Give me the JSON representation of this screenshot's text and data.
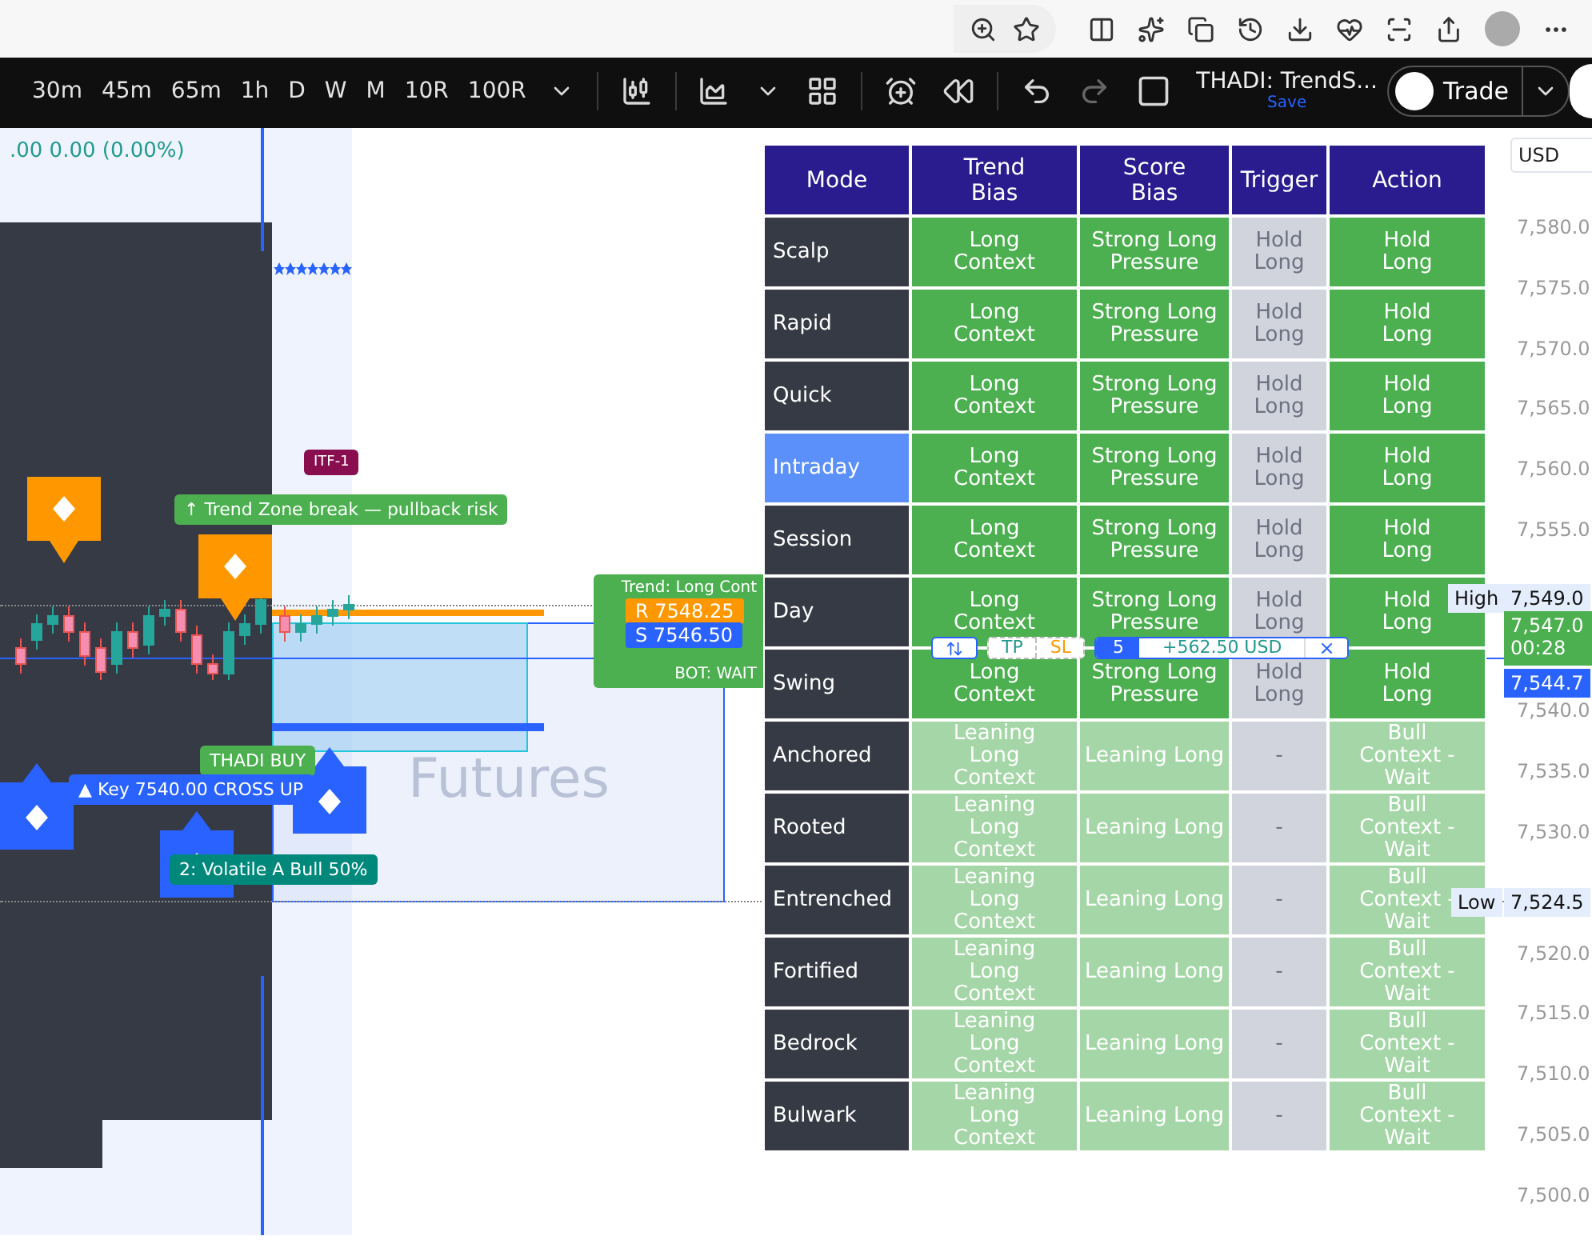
{
  "chart_toolbar": {
    "intervals": [
      "30m",
      "45m",
      "65m",
      "1h",
      "D",
      "W",
      "M",
      "10R",
      "100R"
    ],
    "title": "THADI: TrendS...",
    "save": "Save",
    "trade": "Trade"
  },
  "chart": {
    "change": ".00 0.00 (0.00%)",
    "itf": "ITF-1",
    "trend_zone": "↑ Trend Zone break — pullback risk",
    "trend_lines": [
      "Trend: Long Cont",
      "BOT: WAIT"
    ],
    "resistance": "R 7548.25",
    "support": "S 7546.50",
    "buy": "THADI BUY",
    "key": "▲ Key 7540.00 CROSS UP",
    "volatile": "2: Volatile A Bull 50%",
    "watermark": "Futures"
  },
  "position": {
    "tp": "TP",
    "sl": "SL",
    "qty": "5",
    "pnl": "+562.50 USD",
    "close": "×"
  },
  "table": {
    "columns": [
      "Mode",
      "Trend Bias",
      "Score Bias",
      "Trigger",
      "Action"
    ],
    "rows": [
      {
        "selected": false,
        "cells": [
          {
            "text": "Scalp",
            "kind": "mode"
          },
          {
            "text": "Long Context",
            "kind": "strong"
          },
          {
            "text": "Strong Long Pressure",
            "kind": "strong"
          },
          {
            "text": "Hold Long",
            "kind": "neutral"
          },
          {
            "text": "Hold Long",
            "kind": "strong"
          }
        ]
      },
      {
        "selected": false,
        "cells": [
          {
            "text": "Rapid",
            "kind": "mode"
          },
          {
            "text": "Long Context",
            "kind": "strong"
          },
          {
            "text": "Strong Long Pressure",
            "kind": "strong"
          },
          {
            "text": "Hold Long",
            "kind": "neutral"
          },
          {
            "text": "Hold Long",
            "kind": "strong"
          }
        ]
      },
      {
        "selected": false,
        "cells": [
          {
            "text": "Quick",
            "kind": "mode"
          },
          {
            "text": "Long Context",
            "kind": "strong"
          },
          {
            "text": "Strong Long Pressure",
            "kind": "strong"
          },
          {
            "text": "Hold Long",
            "kind": "neutral"
          },
          {
            "text": "Hold Long",
            "kind": "strong"
          }
        ]
      },
      {
        "selected": true,
        "cells": [
          {
            "text": "Intraday",
            "kind": "mode"
          },
          {
            "text": "Long Context",
            "kind": "strong"
          },
          {
            "text": "Strong Long Pressure",
            "kind": "strong"
          },
          {
            "text": "Hold Long",
            "kind": "neutral"
          },
          {
            "text": "Hold Long",
            "kind": "strong"
          }
        ]
      },
      {
        "selected": false,
        "cells": [
          {
            "text": "Session",
            "kind": "mode"
          },
          {
            "text": "Long Context",
            "kind": "strong"
          },
          {
            "text": "Strong Long Pressure",
            "kind": "strong"
          },
          {
            "text": "Hold Long",
            "kind": "neutral"
          },
          {
            "text": "Hold Long",
            "kind": "strong"
          }
        ]
      },
      {
        "selected": false,
        "cells": [
          {
            "text": "Day",
            "kind": "mode"
          },
          {
            "text": "Long Context",
            "kind": "strong"
          },
          {
            "text": "Strong Long Pressure",
            "kind": "strong"
          },
          {
            "text": "Hold Long",
            "kind": "neutral"
          },
          {
            "text": "Hold Long",
            "kind": "strong"
          }
        ]
      },
      {
        "selected": false,
        "cells": [
          {
            "text": "Swing",
            "kind": "mode"
          },
          {
            "text": "Long Context",
            "kind": "strong"
          },
          {
            "text": "Strong Long Pressure",
            "kind": "strong"
          },
          {
            "text": "Hold Long",
            "kind": "neutral"
          },
          {
            "text": "Hold Long",
            "kind": "strong"
          }
        ]
      },
      {
        "selected": false,
        "cells": [
          {
            "text": "Anchored",
            "kind": "mode"
          },
          {
            "text": "Leaning Long Context",
            "kind": "weak"
          },
          {
            "text": "Leaning Long",
            "kind": "weak"
          },
          {
            "text": "-",
            "kind": "neutral"
          },
          {
            "text": "Bull Context - Wait",
            "kind": "weak"
          }
        ]
      },
      {
        "selected": false,
        "cells": [
          {
            "text": "Rooted",
            "kind": "mode"
          },
          {
            "text": "Leaning Long Context",
            "kind": "weak"
          },
          {
            "text": "Leaning Long",
            "kind": "weak"
          },
          {
            "text": "-",
            "kind": "neutral"
          },
          {
            "text": "Bull Context - Wait",
            "kind": "weak"
          }
        ]
      },
      {
        "selected": false,
        "cells": [
          {
            "text": "Entrenched",
            "kind": "mode"
          },
          {
            "text": "Leaning Long Context",
            "kind": "weak"
          },
          {
            "text": "Leaning Long",
            "kind": "weak"
          },
          {
            "text": "-",
            "kind": "neutral"
          },
          {
            "text": "Bull Context - Wait",
            "kind": "weak"
          }
        ]
      },
      {
        "selected": false,
        "cells": [
          {
            "text": "Fortified",
            "kind": "mode"
          },
          {
            "text": "Leaning Long Context",
            "kind": "weak"
          },
          {
            "text": "Leaning Long",
            "kind": "weak"
          },
          {
            "text": "-",
            "kind": "neutral"
          },
          {
            "text": "Bull Context - Wait",
            "kind": "weak"
          }
        ]
      },
      {
        "selected": false,
        "cells": [
          {
            "text": "Bedrock",
            "kind": "mode"
          },
          {
            "text": "Leaning Long Context",
            "kind": "weak"
          },
          {
            "text": "Leaning Long",
            "kind": "weak"
          },
          {
            "text": "-",
            "kind": "neutral"
          },
          {
            "text": "Bull Context - Wait",
            "kind": "weak"
          }
        ]
      },
      {
        "selected": false,
        "cells": [
          {
            "text": "Bulwark",
            "kind": "mode"
          },
          {
            "text": "Leaning Long Context",
            "kind": "weak"
          },
          {
            "text": "Leaning Long",
            "kind": "weak"
          },
          {
            "text": "-",
            "kind": "neutral"
          },
          {
            "text": "Bull Context - Wait",
            "kind": "weak"
          }
        ]
      }
    ]
  },
  "price_axis": {
    "currency": "USD",
    "ticks_upper": [
      "7,580.0",
      "7,575.0",
      "7,570.0",
      "7,565.0",
      "7,560.0",
      "7,555.0"
    ],
    "ticks_middle": [
      "7,540.0",
      "7,535.0",
      "7,530.0"
    ],
    "ticks_lower": [
      "7,520.0",
      "7,515.0",
      "7,510.0",
      "7,505.0",
      "7,500.0"
    ],
    "high": {
      "label": "High",
      "value": "7,549.0"
    },
    "last": {
      "value": "7,547.0",
      "countdown": "00:28"
    },
    "current": "7,544.7",
    "low": {
      "label": "Low",
      "value": "7,524.5"
    }
  }
}
